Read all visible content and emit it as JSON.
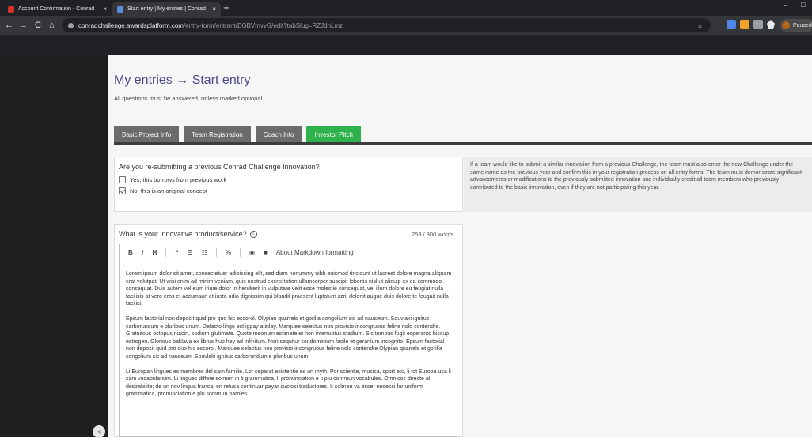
{
  "browser": {
    "tabs": [
      {
        "title": "Account Confirmation - Conrad",
        "icon": "gmail-icon",
        "close": "×"
      },
      {
        "title": "Start entry | My entries | Conrad",
        "icon": "awards-platform-icon",
        "close": "×"
      }
    ],
    "new_tab": "+",
    "window_min": "–",
    "window_max": "□",
    "nav_back": "←",
    "nav_forward": "→",
    "nav_reload": "C",
    "nav_home": "⌂",
    "url_host": "conradchallenge.awardsplatform.com",
    "url_path": "/entry-form/entrant/EGBVmvyG/edit?tabSlug=RZJdnLmz",
    "star": "☆",
    "profile_label": "Paused"
  },
  "header": {
    "title": "My entries → Start entry",
    "subtitle": "All questions must be answered, unless marked optional."
  },
  "tabs": [
    {
      "label": "Basic Project Info",
      "active": false
    },
    {
      "label": "Team Registration",
      "active": false
    },
    {
      "label": "Coach Info",
      "active": false
    },
    {
      "label": "Investor Pitch",
      "active": true
    }
  ],
  "question1": {
    "title": "Are you re-submitting a previous Conrad Challenge Innovation?",
    "options": [
      {
        "label": "Yes, this borrows from previous work",
        "checked": false
      },
      {
        "label": "No, this is an original concept",
        "checked": true
      }
    ],
    "help": "If a team would like to submit a similar innovation from a previous Challenge, the team must also enter the new Challenge under the same name as the previous year and confirm this in your registration process on all entry forms. The team must demonstrate significant advancements or modifications to the previously submitted innovation and individually credit all team members who previously contributed to the basic innovation, even if they are not participating this year."
  },
  "question2": {
    "title": "What is your innovative product/service?",
    "word_count": "253 / 300 words",
    "toolbar": {
      "bold": "B",
      "italic": "I",
      "heading": "H",
      "quote": "❝",
      "ul": "☰",
      "ol": "☷",
      "link": "%",
      "preview": "◉",
      "guide": "■",
      "markdown_link": "About Markdown formatting"
    },
    "paragraphs": [
      "Lorem ipsum dolor sit amet, consectetuer adipiscing elit, sed diam nonummy nibh euismod tincidunt ut laoreet dolore magna aliquam erat volutpat. Ut wisi enim ad minim veniam, quis nostrud exerci tation ullamcorper suscipit lobortis nisl ut aliquip ex ea commodo consequat. Duis autem vel eum iriure dolor in hendrerit in vulputate velit esse molestie consequat, vel illum dolore eu feugiat nulla facilisis at vero eros et accumsan et iusto odio dignissim qui blandit praesent luptatum zzril delenit augue duis dolore te feugait nulla facilisi.",
      "Epsum factorial non deposit quid pro quo hic escorol. Olypian quarrels et gorilla congolium sic ad nauseum. Souvlaki ignitus carborundum e pluribus unum. Defacto lingo est igpay atinlay. Marquee selectus non provisio incongruous feline nolo contendre. Gratuitous octopus niacin, sodium glutimate. Quote meon an estimate et non interruptus stadium. Sic tempus fugit esperanto hiccup estrogen. Glorious baklava ex librus hup hey ad infinitum. Non sequitur condominium facile et geranium incognito. Epsum factorial non deposit quid pro quo hic escorol. Marquee selectus non provisio incongruous feline nolo contendre Olypian quarrels et gorilla congolium sic ad nauseum. Souvlaki ignitus carborundum e pluribus unum.",
      "Li Europan lingues es membres del sam familie. Lor separat existentie es un myth. Por scientie, musica, sport etc, li tot Europa usa li sam vocabularium. Li lingues differe solmen in li grammatica, li pronunciation e li plu commun vocabules. Omnicos directe al desirabilite; de un nov lingua franca; on refusa continuar payar custosi traductores. It solmen va esser necessi far uniform grammatica, pronunciation e plu sommun paroles."
    ]
  },
  "sidebar": {
    "toggle": "<"
  },
  "colors": {
    "active_tab": "#2fb14b",
    "inactive_tab": "#6b6b6b",
    "title": "#4a4a8a"
  }
}
